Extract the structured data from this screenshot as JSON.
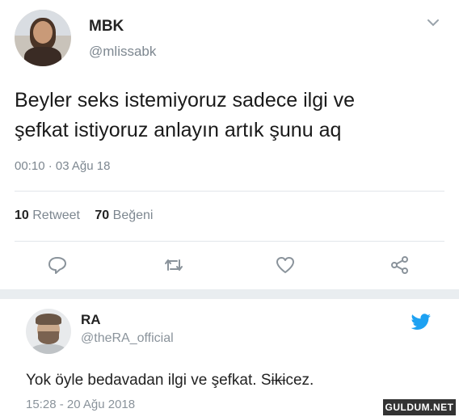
{
  "tweet": {
    "name": "MBK",
    "handle": "@mlissabk",
    "text_line1": "Beyler seks istemiyoruz sadece ilgi ve",
    "text_line2": "şefkat istiyoruz anlayın artık şunu aq",
    "timestamp": "00:10 · 03 Ağu 18",
    "retweet_count": "10",
    "retweet_label": "Retweet",
    "like_count": "70",
    "like_label": "Beğeni",
    "menu_icon": "chevron-down-icon",
    "actions": [
      "reply-icon",
      "retweet-icon",
      "like-icon",
      "share-icon"
    ]
  },
  "reply": {
    "name": "RA",
    "handle": "@theRA_official",
    "text_before": "Yok öyle bedavadan ilgi ve şefkat. S",
    "text_struck": "iki",
    "text_after": "cez.",
    "timestamp": "15:28 - 20 Ağu 2018",
    "brand_icon": "twitter-bird-icon"
  },
  "watermark": {
    "text": "GULDUM.NET"
  },
  "colors": {
    "muted": "#7d8790",
    "twitter_blue": "#1da1f2",
    "divider": "#e2e6ea",
    "separator": "#e9edf0"
  }
}
